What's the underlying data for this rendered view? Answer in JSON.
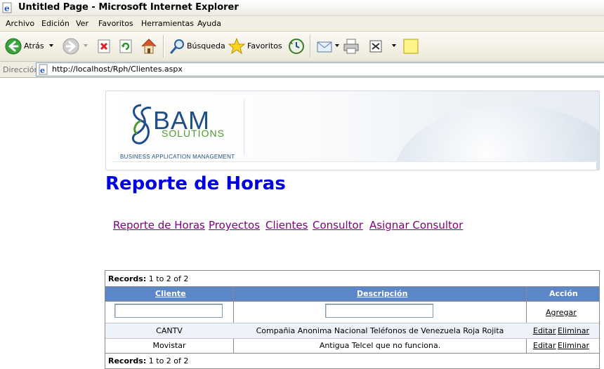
{
  "window": {
    "title": "Untitled Page - Microsoft Internet Explorer"
  },
  "menu": [
    "Archivo",
    "Edición",
    "Ver",
    "Favoritos",
    "Herramientas",
    "Ayuda"
  ],
  "toolbar": {
    "back_label": "Atrás",
    "search_label": "Búsqueda",
    "favorites_label": "Favoritos"
  },
  "address": {
    "label": "Dirección",
    "url": "http://localhost/Rph/Clientes.aspx"
  },
  "banner": {
    "logo_main": "BAM",
    "logo_sub": "SOLUTIONS",
    "logo_tagline": "BUSINESS APPLICATION MANAGEMENT"
  },
  "page": {
    "title": "Reporte de Horas",
    "nav": [
      "Reporte de Horas",
      "Proyectos",
      "Clientes",
      "Consultor",
      "Asignar Consultor"
    ]
  },
  "grid": {
    "records_label": "Records:",
    "records_text": "1 to 2 of 2",
    "headers": {
      "cliente": "Cliente",
      "descripcion": "Descripción",
      "accion": "Acción"
    },
    "add_link": "Agregar",
    "rows": [
      {
        "cliente": "CANTV",
        "descripcion": "Compañia Anonima Nacional Teléfonos de Venezuela Roja Rojita",
        "edit": "Editar",
        "delete": "Eliminar"
      },
      {
        "cliente": "Movistar",
        "descripcion": "Antigua Telcel que no funciona.",
        "edit": "Editar",
        "delete": "Eliminar"
      }
    ]
  }
}
